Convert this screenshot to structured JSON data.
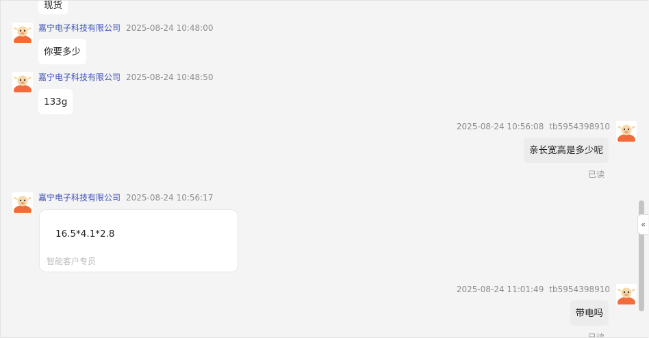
{
  "messages": [
    {
      "text": "现货"
    },
    {
      "sender": "嘉宁电子科技有限公司",
      "time": "2025-08-24 10:48:00",
      "text": "你要多少"
    },
    {
      "sender": "嘉宁电子科技有限公司",
      "time": "2025-08-24 10:48:50",
      "text": "133g"
    },
    {
      "sender": "tb5954398910",
      "time": "2025-08-24 10:56:08",
      "text": "亲长宽高是多少呢",
      "status": "已读"
    },
    {
      "sender": "嘉宁电子科技有限公司",
      "time": "2025-08-24 10:56:17",
      "text": "16.5*4.1*2.8",
      "tag": "智能客户专员"
    },
    {
      "sender": "tb5954398910",
      "time": "2025-08-24 11:01:49",
      "text": "带电吗",
      "status": "已读"
    }
  ],
  "collapse_icon": "«",
  "colors": {
    "sender_name": "#3f51b5",
    "background": "#f4f4f4",
    "sent_bubble": "#ececec"
  },
  "icons": {
    "avatar": "cartoon-ox-avatar-icon",
    "collapse": "double-chevron-left-icon"
  }
}
